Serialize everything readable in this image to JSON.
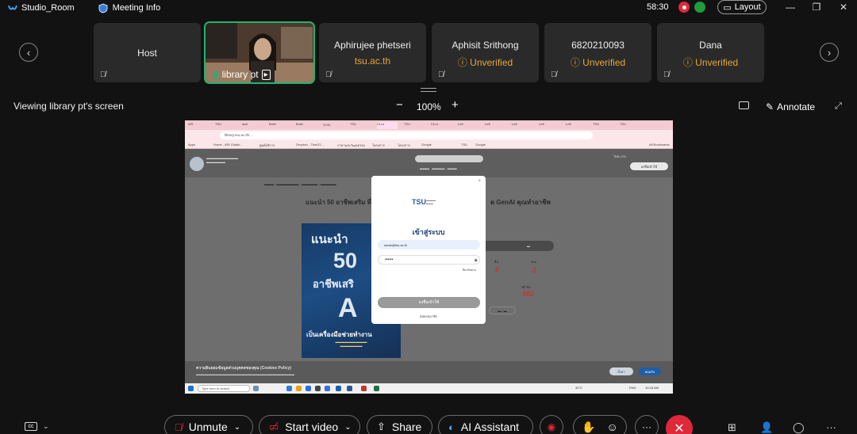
{
  "titlebar": {
    "app_name": "Studio_Room",
    "meeting_info": "Meeting Info",
    "timer": "58:30",
    "layout": "Layout",
    "minimize": "—",
    "restore": "❐",
    "close": "✕"
  },
  "participants": {
    "prev": "‹",
    "next": "›",
    "host": {
      "name": "Host"
    },
    "active_video": {
      "name": "library pt"
    },
    "tiles": [
      {
        "name": "Aphirujee phetseri",
        "sub": "tsu.ac.th"
      },
      {
        "name": "Aphisit Srithong",
        "sub": "Unverified"
      },
      {
        "name": "6820210093",
        "sub": "Unverified"
      },
      {
        "name": "Dana",
        "sub": "Unverified"
      }
    ]
  },
  "share_bar": {
    "viewing": "Viewing library pt's screen",
    "zoom_minus": "−",
    "zoom": "100%",
    "zoom_plus": "+",
    "annotate": "Annotate"
  },
  "shared_screen": {
    "url": "library.tsu.ac.th/...",
    "tabs": [
      "WS",
      "TSU",
      "assi",
      "Bulki",
      "Bulki",
      "ระบบ",
      "TSU",
      "CU-e",
      "TSU",
      "CU-e",
      "Left",
      "Left",
      "Left",
      "Left",
      "Left",
      "TSU",
      "TSU"
    ],
    "bookmarks": [
      "Apps",
      "Home - ARI Citatio...",
      "ศูนย์บริการ",
      "Dropbox - ThaiJO...",
      "ภาษาและวัฒนธรรม",
      "โครงการ",
      "โครงการ",
      "Google",
      "TSU",
      "Google"
    ],
    "all_bookmarks": "All Bookmarks",
    "site_login": "ลงชื่อเข้าใช้",
    "site_lang": "ไทย | EN",
    "headline_left": "แนะนำ 50 อาชีพเสริม ที่",
    "headline_right": "ด GenAI คุณทำอาชีพ",
    "book": {
      "line1": "แนะนำ",
      "line2": "50",
      "line3": "อาชีพเสริ",
      "line4": "A",
      "line5": "เป็นเครื่องมือช่วยทำงาน"
    },
    "stats": [
      {
        "label": "ยืม",
        "value": "0"
      },
      {
        "label": "จอง",
        "value": "2"
      },
      {
        "label": "เข้าชม",
        "value": "382"
      }
    ],
    "cookie_title": "ความยินยอมข้อมูลส่วนบุคคลของคุณ (Cookies Policy)",
    "cookie_accept_btn": "ยอมรับ",
    "cookie_settings_btn": "ตั้งค่า",
    "taskbar_search": "Type here to search",
    "taskbar_weather": "32°C",
    "taskbar_lang": "ENG",
    "taskbar_time": "10:18 AM"
  },
  "login_modal": {
    "title": "เข้าสู่ระบบ",
    "email_value": "name@tsu.ac.th",
    "password_value": "••••••",
    "forgot": "ลืมรหัสผ่าน",
    "login_button": "ลงชื่อเข้าใช้",
    "register": "สมัครสมาชิก",
    "logo": "TSU"
  },
  "controls": {
    "unmute": "Unmute",
    "start_video": "Start video",
    "share": "Share",
    "ai_assistant": "AI Assistant",
    "end": "✕"
  },
  "colors": {
    "background": "#121212",
    "tile": "#2a2a2a",
    "unverified": "#e6a63a",
    "active_border": "#23b36e",
    "end_red": "#e0283b"
  }
}
